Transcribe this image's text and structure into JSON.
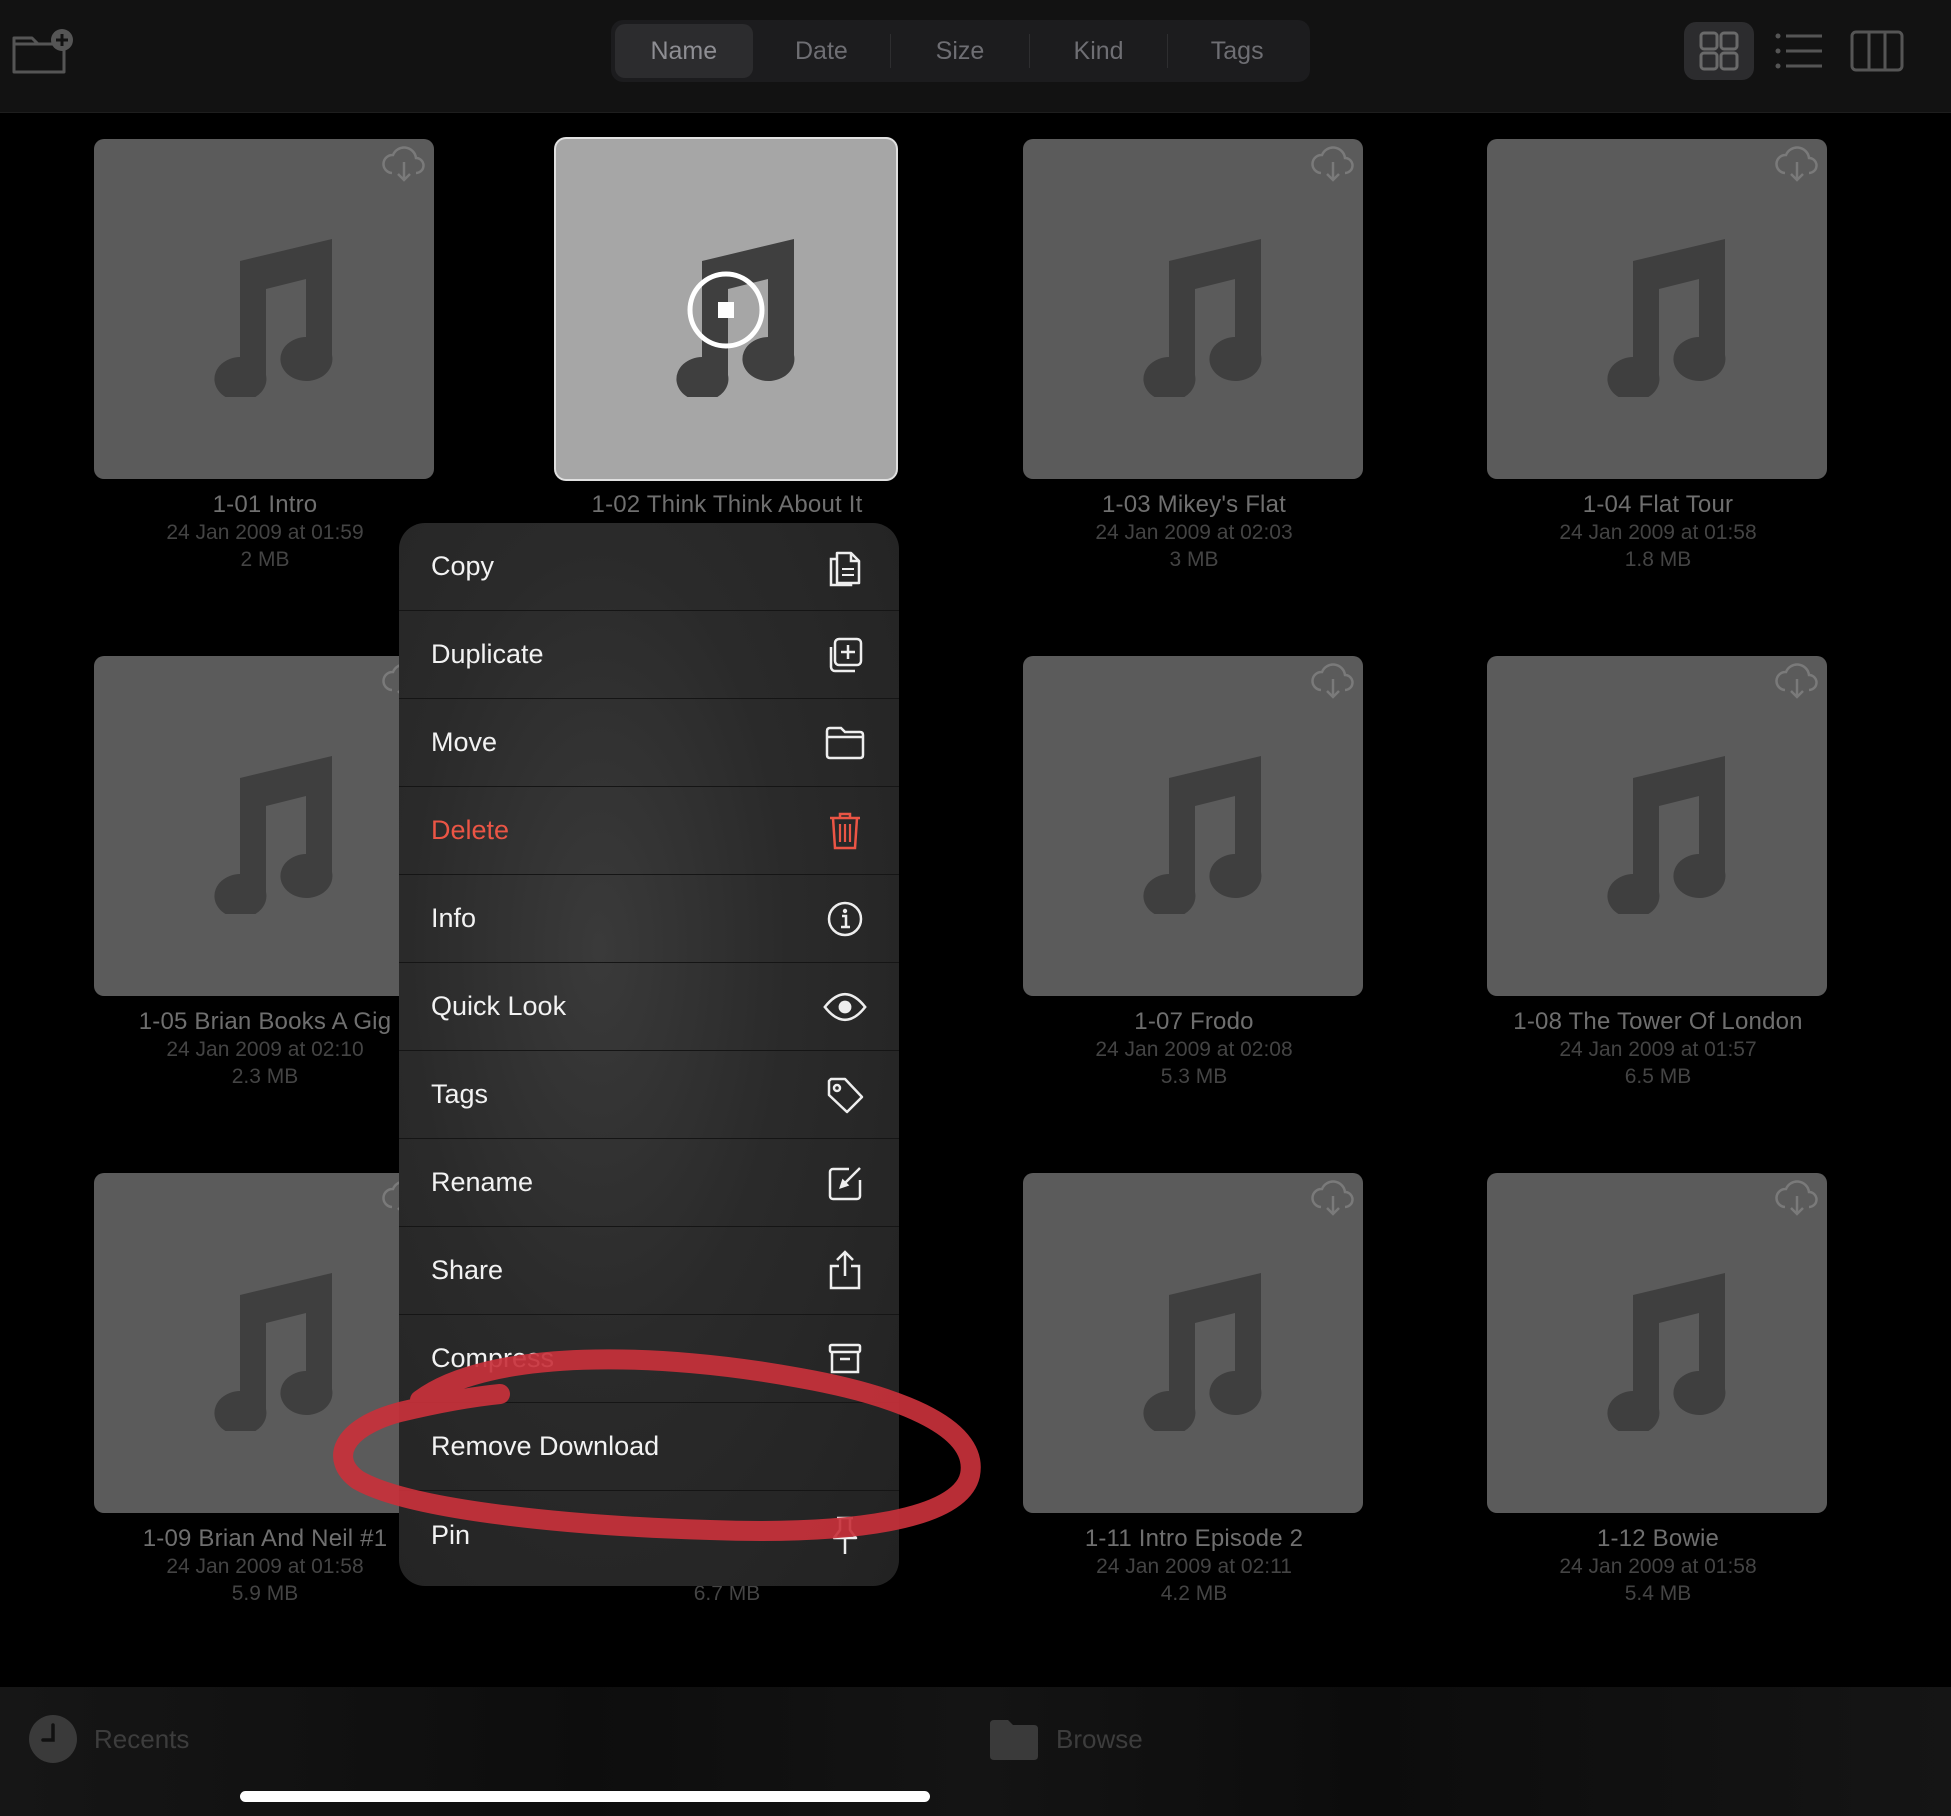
{
  "toolbar": {
    "sort_tabs": [
      {
        "label": "Name",
        "active": true
      },
      {
        "label": "Date",
        "active": false
      },
      {
        "label": "Size",
        "active": false
      },
      {
        "label": "Kind",
        "active": false
      },
      {
        "label": "Tags",
        "active": false
      }
    ],
    "view_modes": [
      "grid-view-icon",
      "list-view-icon",
      "column-view-icon"
    ],
    "active_view": "grid"
  },
  "files": [
    {
      "name": "1-01 Intro",
      "date": "24 Jan 2009 at 01:59",
      "size": "2 MB",
      "cloud": true
    },
    {
      "name": "1-02 Think Think About It",
      "date": "",
      "size": "",
      "cloud": false,
      "selected": true
    },
    {
      "name": "1-03 Mikey's Flat",
      "date": "24 Jan 2009 at 02:03",
      "size": "3 MB",
      "cloud": true
    },
    {
      "name": "1-04 Flat Tour",
      "date": "24 Jan 2009 at 01:58",
      "size": "1.8 MB",
      "cloud": true
    },
    {
      "name": "1-05 Brian Books A Gig",
      "date": "24 Jan 2009 at 02:10",
      "size": "2.3 MB",
      "cloud": true
    },
    {
      "name": "",
      "date": "",
      "size": "",
      "cloud": false
    },
    {
      "name": "1-07 Frodo",
      "date": "24 Jan 2009 at 02:08",
      "size": "5.3 MB",
      "cloud": true
    },
    {
      "name": "1-08 The Tower Of London",
      "date": "24 Jan 2009 at 01:57",
      "size": "6.5 MB",
      "cloud": true
    },
    {
      "name": "1-09 Brian And Neil #1",
      "date": "24 Jan 2009 at 01:58",
      "size": "5.9 MB",
      "cloud": true
    },
    {
      "name": "",
      "date": "",
      "size": "6.7 MB",
      "cloud": false
    },
    {
      "name": "1-11 Intro Episode 2",
      "date": "24 Jan 2009 at 02:11",
      "size": "4.2 MB",
      "cloud": true
    },
    {
      "name": "1-12 Bowie",
      "date": "24 Jan 2009 at 01:58",
      "size": "5.4 MB",
      "cloud": true
    }
  ],
  "context_menu": {
    "items": [
      {
        "label": "Copy",
        "icon": "copy-icon",
        "destructive": false
      },
      {
        "label": "Duplicate",
        "icon": "duplicate-icon",
        "destructive": false
      },
      {
        "label": "Move",
        "icon": "folder-icon",
        "destructive": false
      },
      {
        "label": "Delete",
        "icon": "trash-icon",
        "destructive": true
      },
      {
        "label": "Info",
        "icon": "info-icon",
        "destructive": false
      },
      {
        "label": "Quick Look",
        "icon": "eye-icon",
        "destructive": false
      },
      {
        "label": "Tags",
        "icon": "tag-icon",
        "destructive": false
      },
      {
        "label": "Rename",
        "icon": "rename-icon",
        "destructive": false
      },
      {
        "label": "Share",
        "icon": "share-icon",
        "destructive": false
      },
      {
        "label": "Compress",
        "icon": "archive-icon",
        "destructive": false
      },
      {
        "label": "Remove Download",
        "icon": "",
        "destructive": false,
        "circled": true
      },
      {
        "label": "Pin",
        "icon": "pin-icon",
        "destructive": false
      }
    ]
  },
  "tabbar": {
    "recents": "Recents",
    "browse": "Browse"
  },
  "colors": {
    "background": "#000000",
    "thumb": "#5b5b5b",
    "selected_thumb": "#a6a6a6",
    "menu_bg": "#2a2a2a",
    "destructive": "#eb5545",
    "annotation": "#c8313b"
  }
}
